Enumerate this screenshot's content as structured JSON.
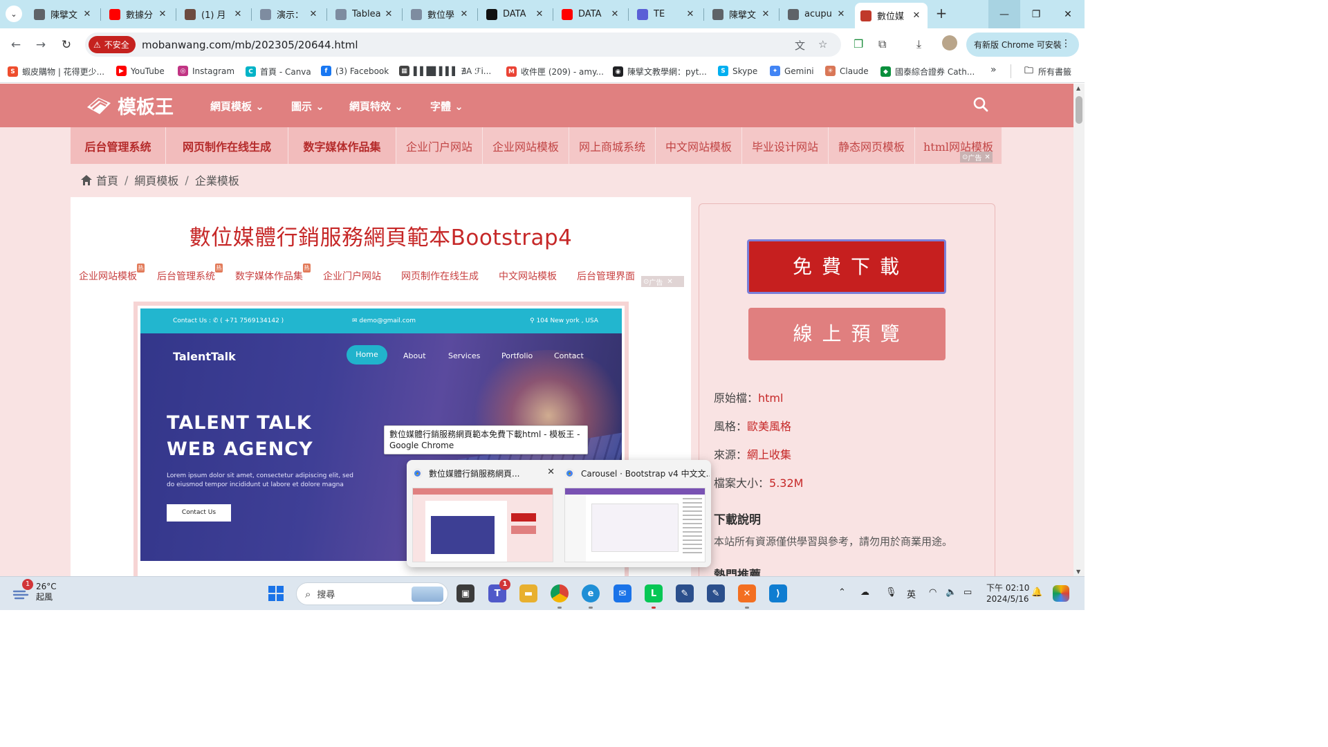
{
  "tabs": [
    {
      "label": "陳擘文",
      "color": "#5f6368"
    },
    {
      "label": "數據分",
      "color": "#ff0000"
    },
    {
      "label": "(1) 月",
      "color": "#6d4c41"
    },
    {
      "label": "演示：",
      "color": "#7e8ca0"
    },
    {
      "label": "Tablea",
      "color": "#7e8ca0"
    },
    {
      "label": "數位學",
      "color": "#7e8ca0"
    },
    {
      "label": "DATA",
      "color": "#111111"
    },
    {
      "label": "DATA",
      "color": "#ff0000"
    },
    {
      "label": "TE",
      "color": "#5a5fd6"
    },
    {
      "label": "陳擘文",
      "color": "#5f6368"
    },
    {
      "label": "acupu",
      "color": "#5f6368"
    },
    {
      "label": "數位媒",
      "color": "#c0392b"
    }
  ],
  "toolbar": {
    "insecure_label": "不安全",
    "url": "mobanwang.com/mb/202305/20644.html",
    "update_label": "有新版 Chrome 可安裝"
  },
  "bookmarks": [
    {
      "label": "蝦皮購物 | 花得更少...",
      "color": "#ee4d2d",
      "glyph": "S"
    },
    {
      "label": "YouTube",
      "color": "#ff0000",
      "glyph": "▶"
    },
    {
      "label": "Instagram",
      "color": "#c13584",
      "glyph": "◎"
    },
    {
      "label": "首頁 - Canva",
      "color": "#00b3c7",
      "glyph": "C"
    },
    {
      "label": "(3) Facebook",
      "color": "#1877f2",
      "glyph": "f"
    },
    {
      "label": "▌▌█▌▌▌▌ ∄A ℱi...",
      "color": "#444444",
      "glyph": "▦"
    },
    {
      "label": "收件匣 (209) - amy...",
      "color": "#ea4335",
      "glyph": "M"
    },
    {
      "label": "陳擘文教學網：pyt...",
      "color": "#202124",
      "glyph": "◉"
    },
    {
      "label": "Skype",
      "color": "#00aff0",
      "glyph": "S"
    },
    {
      "label": "Gemini",
      "color": "#4285f4",
      "glyph": "✦"
    },
    {
      "label": "Claude",
      "color": "#d97757",
      "glyph": "✳"
    },
    {
      "label": "國泰綜合證券 Cath...",
      "color": "#0a8f3c",
      "glyph": "◆"
    }
  ],
  "bookmarks_all": "所有書籤",
  "site": {
    "logo": "模板王",
    "nav": [
      "網頁模板",
      "圖示",
      "網頁特效",
      "字體"
    ],
    "ad_links": [
      "后台管理系统",
      "网页制作在线生成",
      "数字媒体作品集",
      "企业门户网站",
      "企业网站模板",
      "网上商城系统",
      "中文网站模板",
      "毕业设计网站",
      "静态网页模板",
      "html网站模板"
    ],
    "ad_label": "广告",
    "breadcrumb": [
      "首頁",
      "網頁模板",
      "企業模板"
    ],
    "title": "數位媒體行銷服務網頁範本Bootstrap4",
    "tags": [
      "企业网站模板",
      "后台管理系统",
      "数字媒体作品集",
      "企业门户网站",
      "网页制作在线生成",
      "中文网站模板",
      "后台管理界面"
    ],
    "hot_label": "热",
    "preview": {
      "contact": "Contact Us : ✆ ( +71 7569134142 )",
      "email": "✉ demo@gmail.com",
      "location": "⚲ 104 New york , USA",
      "brand": "TalentTalk",
      "menu": [
        "Home",
        "About",
        "Services",
        "Portfolio",
        "Contact"
      ],
      "headline_1": "TALENT TALK",
      "headline_2": "WEB AGENCY",
      "body": "Lorem ipsum dolor sit amet, consectetur adipiscing elit, sed do eiusmod tempor incididunt ut labore et dolore magna",
      "cta": "Contact Us"
    },
    "download_btn": "免費下載",
    "preview_btn": "線上預覽",
    "meta": [
      {
        "key": "原始檔：",
        "value": "html"
      },
      {
        "key": "風格：",
        "value": "歐美風格"
      },
      {
        "key": "來源：",
        "value": "網上收集"
      },
      {
        "key": "檔案大小：",
        "value": "5.32M"
      }
    ],
    "download_note_title": "下載說明",
    "download_note": "本站所有資源僅供學習與參考，請勿用於商業用途。",
    "hot_title": "熱門推薦"
  },
  "tooltip": "數位媒體行銷服務網頁範本免費下載html - 模板王 - Google Chrome",
  "thumbnails": [
    {
      "title": "數位媒體行銷服務網頁..."
    },
    {
      "title": "Carousel · Bootstrap v4 中文文..."
    }
  ],
  "taskbar": {
    "weather_badge": "1",
    "temp": "26°C",
    "condition": "起風",
    "search_placeholder": "搜尋",
    "teams_badge": "1",
    "ime": "英",
    "time": "下午 02:10",
    "date": "2024/5/16"
  }
}
